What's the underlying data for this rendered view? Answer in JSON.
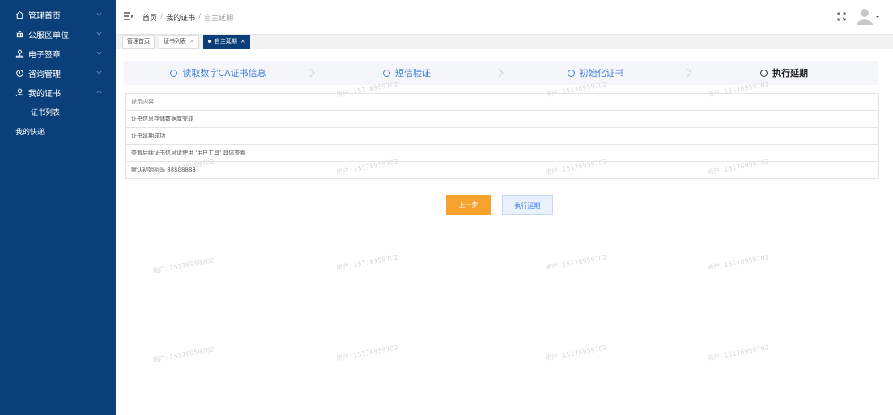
{
  "sidebar": {
    "items": [
      {
        "label": "管理首页",
        "icon": "home-icon"
      },
      {
        "label": "公服区单位",
        "icon": "building-icon"
      },
      {
        "label": "电子签章",
        "icon": "user-stamp-icon"
      },
      {
        "label": "咨询管理",
        "icon": "chat-icon"
      },
      {
        "label": "我的证书",
        "icon": "person-icon"
      }
    ],
    "sub_item": "证书列表",
    "plain_item": "我的快递"
  },
  "breadcrumb": {
    "home": "首页",
    "sep1": "/",
    "cert": "我的证书",
    "sep2": "/",
    "current": "自主延期"
  },
  "tabs": [
    {
      "label": "管理首页"
    },
    {
      "label": "证书列表",
      "close": "×"
    },
    {
      "label": "自主延期",
      "close": "×"
    }
  ],
  "steps": [
    {
      "label": "读取数字CA证书信息"
    },
    {
      "label": "短信验证"
    },
    {
      "label": "初始化证书"
    },
    {
      "label": "执行延期"
    }
  ],
  "info": {
    "header": "提示内容",
    "rows": [
      "证书信息存储数据库完成",
      "证书延期成功",
      "查看后续证书信息请使用 '用户工具' 具体查看",
      "默认初始密码 88888888"
    ]
  },
  "buttons": {
    "prev": "上一步",
    "exec": "执行延期"
  },
  "watermark": "用户: 15176959702",
  "colors": {
    "sidebar_bg": "#0a3f7a",
    "accent_blue": "#3f7fe1",
    "prev_button": "#f7a12f"
  }
}
